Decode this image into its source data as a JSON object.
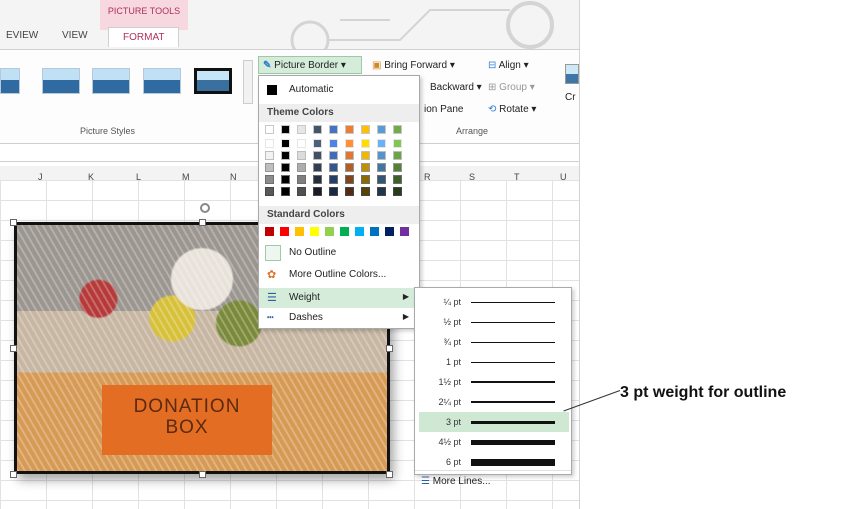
{
  "ribbon": {
    "tools_label": "PICTURE TOOLS",
    "tabs": [
      "EVIEW",
      "VIEW",
      "FORMAT"
    ],
    "group_labels": {
      "styles": "Picture Styles",
      "arrange": "Arrange"
    },
    "border_button": "Picture Border",
    "bring_forward": "Bring Forward",
    "align": "Align",
    "backward": "Backward",
    "group": "Group",
    "pane": "ion Pane",
    "rotate": "Rotate",
    "crop_partial": "Cr"
  },
  "columns": [
    "J",
    "K",
    "L",
    "M",
    "N",
    "R",
    "S",
    "T",
    "U"
  ],
  "picture_text": "DONATION\nBOX",
  "menu": {
    "automatic": "Automatic",
    "theme_colors": "Theme Colors",
    "standard_colors": "Standard Colors",
    "no_outline": "No Outline",
    "more_colors": "More Outline Colors...",
    "weight": "Weight",
    "dashes": "Dashes"
  },
  "theme_colors": [
    "#ffffff",
    "#000000",
    "#e7e6e6",
    "#44546a",
    "#4472c4",
    "#ed7d31",
    "#ffc000",
    "#5b9bd5",
    "#70ad47"
  ],
  "standard_colors": [
    "#c00000",
    "#ff0000",
    "#ffc000",
    "#ffff00",
    "#92d050",
    "#00b050",
    "#00b0f0",
    "#0070c0",
    "#002060",
    "#7030a0"
  ],
  "weights": [
    {
      "label": "¼ pt",
      "thickness": 0.25
    },
    {
      "label": "½ pt",
      "thickness": 0.5
    },
    {
      "label": "¾ pt",
      "thickness": 0.75
    },
    {
      "label": "1 pt",
      "thickness": 1
    },
    {
      "label": "1½ pt",
      "thickness": 1.5
    },
    {
      "label": "2¼ pt",
      "thickness": 2.25
    },
    {
      "label": "3 pt",
      "thickness": 3
    },
    {
      "label": "4½ pt",
      "thickness": 4.5
    },
    {
      "label": "6 pt",
      "thickness": 6
    }
  ],
  "selected_weight": "3 pt",
  "more_lines": "More Lines...",
  "callout": "3 pt weight for outline"
}
